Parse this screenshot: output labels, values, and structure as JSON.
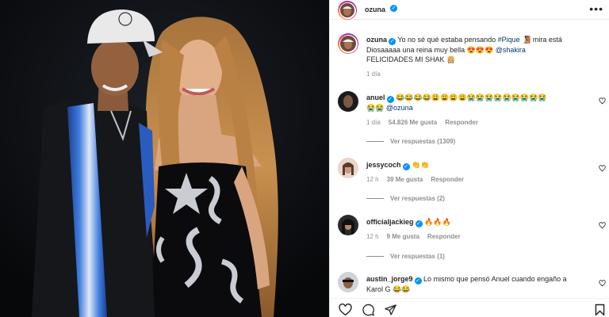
{
  "header": {
    "username": "ozuna",
    "more_label": "•••"
  },
  "caption": {
    "username": "ozuna",
    "line1_pre": "Yo no sé qué estaba pensando ",
    "line1_hashtag": "#Pique",
    "line1_post": " 🧏🏽 mira está",
    "line2_pre": "Diosaaaaa una reina muy bella 😍😍😍 ",
    "line2_mention": "@shakira",
    "line3": "FELICIDADES MI SHAK 👸🏼",
    "time": "1 día"
  },
  "comments": [
    {
      "username": "anuel",
      "text": "😂😂😂😂😩😩😩😩😭😭😭😭😭😭😭😭😭",
      "text2_pre": "😭😭 ",
      "text2_mention": "@ozuna",
      "time": "1 día",
      "likes": "54.826 Me gusta",
      "reply": "Responder",
      "view_replies": "Ver respuestas (1309)"
    },
    {
      "username": "jessycoch",
      "text": "👏👏",
      "time": "12 h",
      "likes": "39 Me gusta",
      "reply": "Responder",
      "view_replies": "Ver respuestas (2)"
    },
    {
      "username": "officialjackieg",
      "text": "🔥🔥🔥",
      "time": "12 h",
      "likes": "9 Me gusta",
      "reply": "Responder",
      "view_replies": "Ver respuestas (1)"
    },
    {
      "username": "austin_jorge9",
      "text": "Lo mismo que pensó Anuel cuando engaño a",
      "text2": "Karol G 😂😂"
    }
  ],
  "colors": {
    "verified": "#0095f6",
    "link": "#00376b",
    "muted": "#8e8e8e"
  },
  "icons": [
    "heart-icon",
    "comment-icon",
    "share-icon",
    "bookmark-icon",
    "more-icon",
    "verified-icon"
  ]
}
